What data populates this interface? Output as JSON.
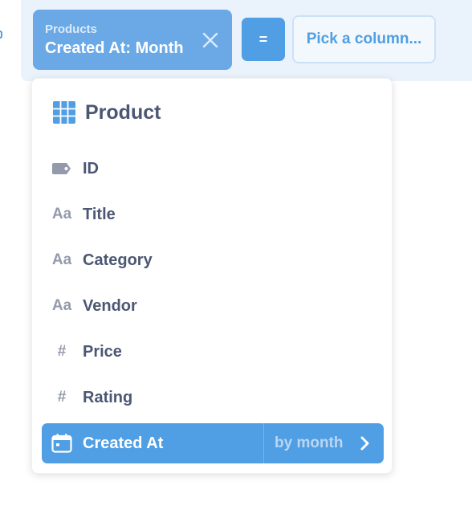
{
  "chip": {
    "subtitle": "Products",
    "title": "Created At: Month"
  },
  "operator": {
    "label": "="
  },
  "rhs": {
    "label": "Pick a column..."
  },
  "popover": {
    "title": "Product",
    "columns": [
      {
        "label": "ID",
        "icon": "label-icon"
      },
      {
        "label": "Title",
        "icon": "text-icon",
        "glyph": "Aa"
      },
      {
        "label": "Category",
        "icon": "text-icon",
        "glyph": "Aa"
      },
      {
        "label": "Vendor",
        "icon": "text-icon",
        "glyph": "Aa"
      },
      {
        "label": "Price",
        "icon": "number-icon",
        "glyph": "#"
      },
      {
        "label": "Rating",
        "icon": "number-icon",
        "glyph": "#"
      },
      {
        "label": "Created At",
        "icon": "calendar-icon",
        "selected": true,
        "bucket": "by month"
      }
    ]
  },
  "colors": {
    "accent": "#509ee3",
    "chip": "#6aa9e6",
    "bar": "#eaf3fc",
    "text": "#4c5773",
    "muted": "#949aab"
  }
}
